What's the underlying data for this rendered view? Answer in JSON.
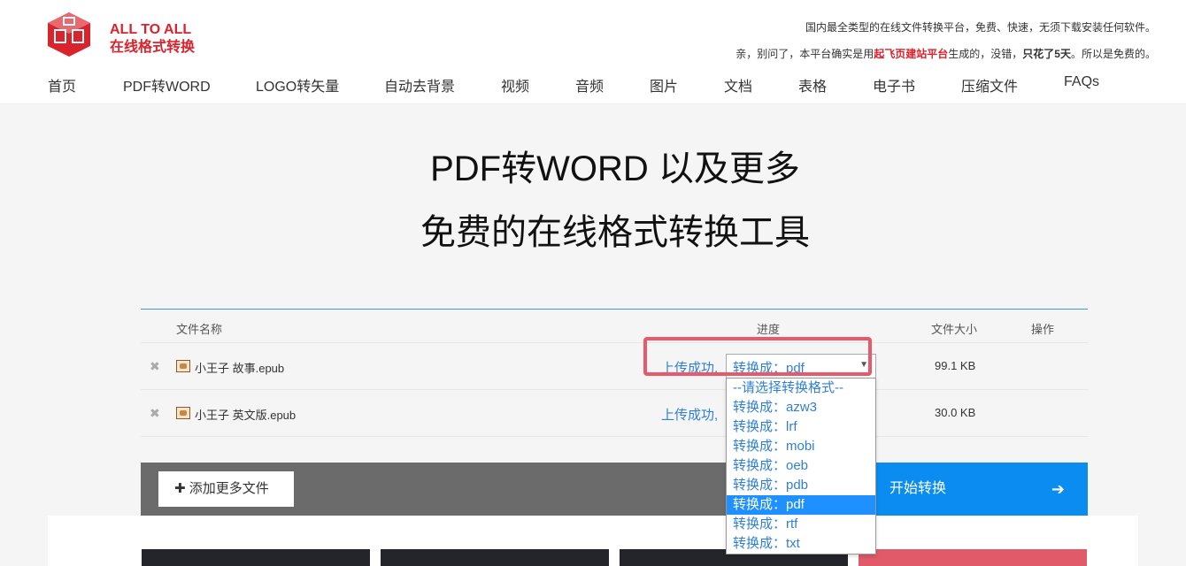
{
  "brand": {
    "line1": "ALL TO ALL",
    "line2": "在线格式转换"
  },
  "tagline": {
    "line1": "国内最全类型的在线文件转换平台，免费、快速，无须下载安装任何软件。",
    "line2_pre": "亲，别问了，本平台确实是用",
    "line2_red": "起飞页建站平台",
    "line2_mid": "生成的，没错，",
    "line2_bold": "只花了5天",
    "line2_post": "。所以是免费的。"
  },
  "nav": [
    "首页",
    "PDF转WORD",
    "LOGO转矢量",
    "自动去背景",
    "视频",
    "音频",
    "图片",
    "文档",
    "表格",
    "电子书",
    "压缩文件",
    "FAQs"
  ],
  "hero": {
    "title": "PDF转WORD 以及更多",
    "subtitle": "免费的在线格式转换工具"
  },
  "table": {
    "headers": {
      "name": "文件名称",
      "progress": "进度",
      "size": "文件大小",
      "action": "操作"
    },
    "rows": [
      {
        "name": "小王子 故事.epub",
        "status": "上传成功,",
        "select": "转换成：pdf",
        "size": "99.1 KB"
      },
      {
        "name": "小王子 英文版.epub",
        "status": "上传成功,",
        "size": "30.0 KB"
      }
    ]
  },
  "dropdown": {
    "options": [
      "--请选择转换格式--",
      "转换成：azw3",
      "转换成：lrf",
      "转换成：mobi",
      "转换成：oeb",
      "转换成：pdb",
      "转换成：pdf",
      "转换成：rtf",
      "转换成：txt"
    ],
    "selected": "转换成：pdf"
  },
  "actions": {
    "add_more": "添加更多文件",
    "start": "开始转换"
  },
  "colors": {
    "brand_red": "#d9232d",
    "accent_blue": "#0a8cf0",
    "highlight": "#e8596b"
  }
}
